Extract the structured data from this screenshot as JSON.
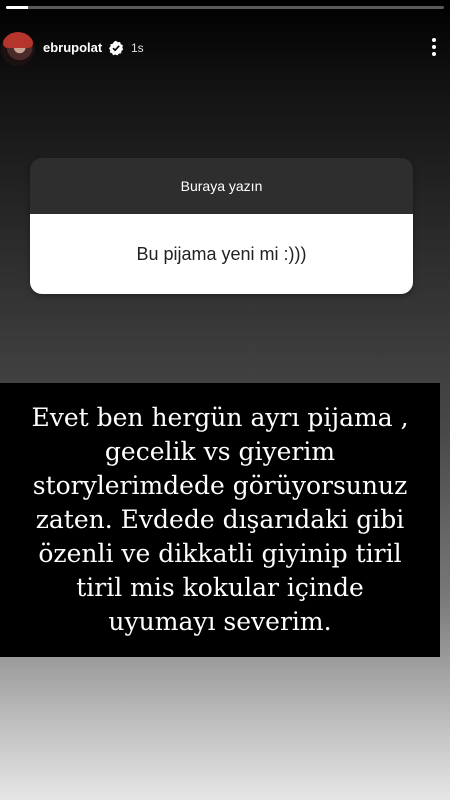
{
  "story": {
    "progress_fraction": 0.05,
    "user": {
      "username": "ebrupolat",
      "verified_icon": "verified-badge-icon",
      "time_ago": "1s"
    },
    "menu_icon": "more-vertical-icon"
  },
  "question_sticker": {
    "prompt": "Buraya yazın",
    "question": "Bu pijama yeni mi :)))"
  },
  "answer": {
    "lines": [
      "Evet ben hergün ayrı pijama ,",
      "gecelik vs giyerim",
      "storylerimdede görüyorsunuz",
      "zaten. Evdede dışarıdaki gibi",
      "özenli ve dikkatli giyinip tiril",
      "tiril mis kokular içinde",
      "uyumayı severim."
    ]
  }
}
